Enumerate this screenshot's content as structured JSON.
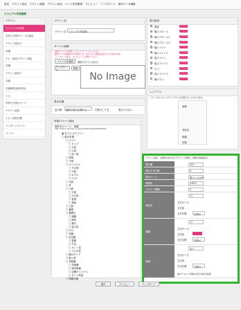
{
  "nav": [
    "設定",
    "デザイン設定",
    "デザイン調整",
    "デザイン設定",
    "ページ作成管理",
    "プレビュー",
    "アップロード",
    "保存データ編集"
  ],
  "page_title": "ビジュアル作成画面",
  "sidebar": {
    "header": "デザイン",
    "items": [
      "ビジュアルの作成",
      "お知らせ表示ページの設定",
      "デザイン設定TL",
      "共通",
      "ナビ・設定/デザイン項目",
      "共通",
      "デザイン設定3",
      "共通",
      "共通参照(保存有効)",
      "ナビ",
      "お知らせ表示ページ",
      "デザイン設定",
      "ナビ・保存位置",
      "フッター/コメント",
      "コーナー",
      "ページ一覧をクリア"
    ]
  },
  "design_name": {
    "header": "デザイン名",
    "label": "デザイン名",
    "value": "ビジュアル作成用"
  },
  "image_panel": {
    "header": "タイトル画像",
    "note1": "画像ファイルを選択してアップロードしてください。",
    "note2": "推奨サイズは横幅800px程度です。表示される画像は設定された内容で表示",
    "note3": "アップロード後は、プレビューでご確認ください。",
    "file_btn": "ファイルを選択",
    "file_status": "選択されていません",
    "upload_btn": "アップロード",
    "delete_btn": "削除",
    "no_image": "No Image"
  },
  "display_pos": {
    "header": "表示位置",
    "label": "並び順",
    "select": "通常の表示位置から",
    "check1": "右寄せにする",
    "check2": "表示させない"
  },
  "target": {
    "header": "対象のページ追加",
    "label": "選択中のページ：",
    "value": "編集",
    "url": "http://item.rakuten.co.jp/meisaikuboki/00000000/",
    "tree": [
      "▣ 全ての カテゴリー",
      "□ 楽天市場",
      "□ ウツワ",
      "□ カップ",
      "□ 大皿",
      "□ 小皿",
      "□ 皿一覧",
      "□ 茶碗",
      "□ 汁椀",
      "□ オリジナル",
      "□ その他",
      "□ 中皿",
      "□ ボウル",
      "□ 2ペア",
      "□ 大鉢",
      "□ 丼",
      "□ 小鉢",
      "□ 中鉢",
      "□ 大平皿",
      "□ 急須",
      "□ 湯呑",
      "□ 土瓶",
      "□ 蓋物",
      "□ 箸置き",
      "□ 酒器",
      "□ 徳利",
      "□ 猪口",
      "□ 銘々皿",
      "□ 片口",
      "□ 花器",
      "□ 弁当箱",
      "□ 重箱",
      "□ 干支",
      "□ カレー皿",
      "□ パスタ皿",
      "□ 器のギフト",
      "□ 新入荷",
      "□ 和食器",
      "□ 洋食器",
      "□ 和洋食器",
      "□ 店舗オリジナル",
      "□ セット商品",
      "□ 陶器の器"
    ]
  },
  "display_settings": {
    "header": "表示設定",
    "options": [
      "通常",
      "横スクロール",
      "横スクロール2",
      "横スクロール3",
      "横スライド",
      "横スライド2",
      "縦スライド",
      "縦スライド2",
      "ロゴ",
      "縦スライド3",
      "横パネル"
    ],
    "tag_text": "プレビュー",
    "selected_index": 5
  },
  "layout": {
    "header": "レイアウト",
    "note": "ドラッグ＆ドロップでレイアウトを変更することができます。",
    "blocks": [
      "画像",
      "商品名",
      "価格",
      "評価"
    ]
  },
  "detail": {
    "header": "デザイン設定　(画像をお好みのデザインで調整し 画像の各種設定)",
    "rows": [
      {
        "label": "表示順",
        "value": "500"
      },
      {
        "label": "表示する行数",
        "value": "6"
      },
      {
        "label": "表示ページ",
        "value": "現ページのみ"
      },
      {
        "label": "背景色",
        "value": "#ffffff"
      },
      {
        "label": "スライド間隔",
        "value": "5"
      },
      {
        "label": "商品名",
        "value": "12"
      },
      {
        "label": "価格",
        "value": "12"
      },
      {
        "label": "評価",
        "value": "あり"
      }
    ],
    "text_size_label": "文字サイズ",
    "text_color_label": "文字色",
    "text_style_label": "文字位置",
    "style_value": "左寄せ",
    "price_color": "#e23a7c",
    "review_note": "星やテキスト評価の表示/非表示設定"
  },
  "buttons": {
    "save": "保存",
    "preview": "プレビュー",
    "upload": "アップロード"
  }
}
